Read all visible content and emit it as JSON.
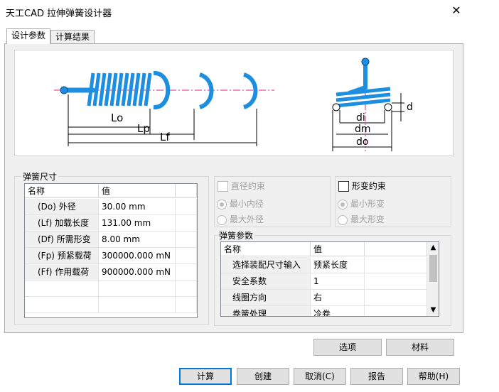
{
  "window": {
    "title": "天工CAD 拉伸弹簧设计器",
    "close_glyph": "✕"
  },
  "tabs": [
    {
      "label": "设计参数"
    },
    {
      "label": "计算结果"
    }
  ],
  "diagram": {
    "labels": {
      "lo": "Lo",
      "lp": "Lp",
      "lf": "Lf",
      "di": "di",
      "dm": "dm",
      "do": "do",
      "d": "d"
    },
    "spring_color": "#1e8fe0"
  },
  "spring_size": {
    "title": "弹簧尺寸",
    "columns": [
      "名称",
      "值"
    ],
    "rows": [
      {
        "name": "(Do) 外径",
        "value": "30.00 mm"
      },
      {
        "name": "(Lf) 加载长度",
        "value": "131.00 mm"
      },
      {
        "name": "(Df) 所需形变",
        "value": "8.00 mm"
      },
      {
        "name": "(Fp) 预紧载荷",
        "value": "300000.000 mN"
      },
      {
        "name": "(Ff) 作用载荷",
        "value": "900000.000 mN"
      }
    ]
  },
  "diameter_constraint": {
    "label": "直径约束",
    "checked": false,
    "options": [
      "最小内径",
      "最大外径"
    ],
    "selected": "最小内径"
  },
  "deform_constraint": {
    "label": "形变约束",
    "checked": false,
    "options": [
      "最小形变",
      "最大形变"
    ],
    "selected": "最小形变"
  },
  "spring_params": {
    "title": "弹簧参数",
    "columns": [
      "名称",
      "值"
    ],
    "rows": [
      {
        "name": "选择装配尺寸输入",
        "value": "预紧长度"
      },
      {
        "name": "安全系数",
        "value": "1"
      },
      {
        "name": "线圈方向",
        "value": "右"
      },
      {
        "name": "卷簧处理",
        "value": "冷卷"
      }
    ]
  },
  "panel_buttons": {
    "options": "选项",
    "material": "材料"
  },
  "footer_buttons": {
    "calculate": "计算",
    "create": "创建",
    "cancel": "取消(C)",
    "report": "报告",
    "help": "帮助(H)"
  }
}
